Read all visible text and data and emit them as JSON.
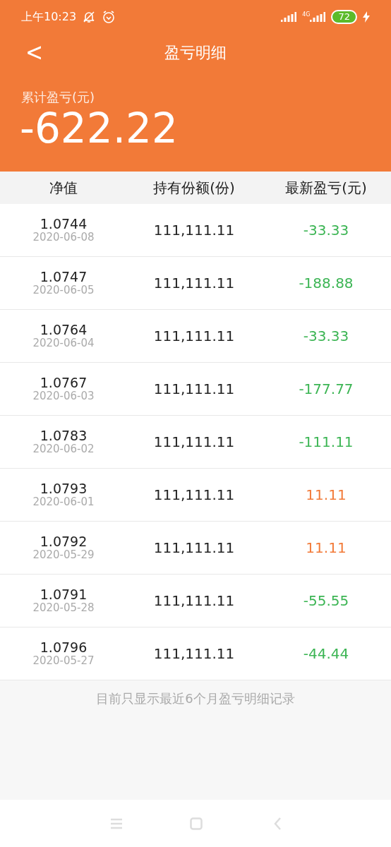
{
  "status_bar": {
    "time": "上午10:23",
    "network": "4G",
    "battery": "72"
  },
  "header": {
    "back": "<",
    "title": "盈亏明细"
  },
  "summary": {
    "label": "累计盈亏(元)",
    "value": "-622.22"
  },
  "table": {
    "columns": [
      "净值",
      "持有份额(份)",
      "最新盈亏(元)"
    ],
    "rows": [
      {
        "nav": "1.0744",
        "date": "2020-06-08",
        "shares": "111,111.11",
        "profit": "-33.33",
        "kind": "loss"
      },
      {
        "nav": "1.0747",
        "date": "2020-06-05",
        "shares": "111,111.11",
        "profit": "-188.88",
        "kind": "loss"
      },
      {
        "nav": "1.0764",
        "date": "2020-06-04",
        "shares": "111,111.11",
        "profit": "-33.33",
        "kind": "loss"
      },
      {
        "nav": "1.0767",
        "date": "2020-06-03",
        "shares": "111,111.11",
        "profit": "-177.77",
        "kind": "loss"
      },
      {
        "nav": "1.0783",
        "date": "2020-06-02",
        "shares": "111,111.11",
        "profit": "-111.11",
        "kind": "loss"
      },
      {
        "nav": "1.0793",
        "date": "2020-06-01",
        "shares": "111,111.11",
        "profit": "11.11",
        "kind": "gain"
      },
      {
        "nav": "1.0792",
        "date": "2020-05-29",
        "shares": "111,111.11",
        "profit": "11.11",
        "kind": "gain"
      },
      {
        "nav": "1.0791",
        "date": "2020-05-28",
        "shares": "111,111.11",
        "profit": "-55.55",
        "kind": "loss"
      },
      {
        "nav": "1.0796",
        "date": "2020-05-27",
        "shares": "111,111.11",
        "profit": "-44.44",
        "kind": "loss"
      }
    ]
  },
  "footer_note": "目前只显示最近6个月盈亏明细记录"
}
